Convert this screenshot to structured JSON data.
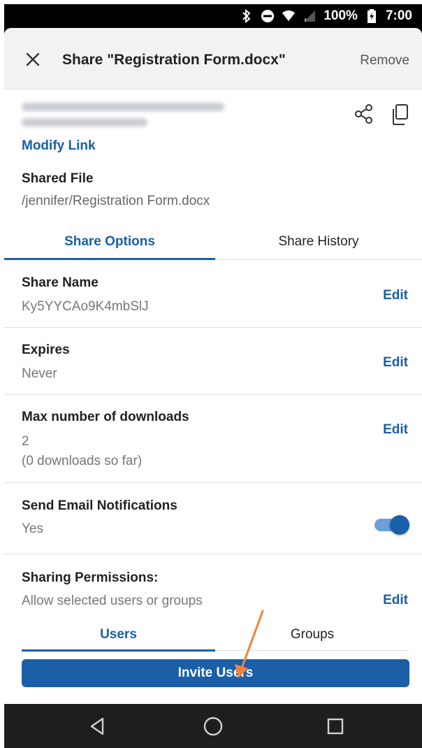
{
  "status_bar": {
    "battery": "100%",
    "time": "7:00",
    "icons": [
      "bluetooth-icon",
      "do-not-disturb-icon",
      "wifi-icon",
      "signal-icon",
      "battery-icon"
    ]
  },
  "header": {
    "title": "Share \"Registration Form.docx\"",
    "remove_label": "Remove",
    "close_icon": "close-icon"
  },
  "link": {
    "url": "(blurred)",
    "share_icon": "share-icon",
    "copy_icon": "copy-icon",
    "modify_label": "Modify Link"
  },
  "shared_file": {
    "label": "Shared File",
    "path": "/jennifer/Registration Form.docx"
  },
  "tabs": [
    {
      "label": "Share Options",
      "active": true
    },
    {
      "label": "Share History",
      "active": false
    }
  ],
  "options": {
    "share_name": {
      "label": "Share Name",
      "value": "Ky5YYCAo9K4mbSlJ",
      "action": "Edit"
    },
    "expires": {
      "label": "Expires",
      "value": "Never",
      "action": "Edit"
    },
    "max_downloads": {
      "label": "Max number of downloads",
      "value": "2",
      "note": "(0 downloads so far)",
      "action": "Edit"
    },
    "email_notifications": {
      "label": "Send Email Notifications",
      "value": "Yes",
      "enabled": true
    },
    "sharing_permissions": {
      "label": "Sharing Permissions:",
      "value": "Allow selected users or groups",
      "action": "Edit"
    }
  },
  "sub_tabs": [
    {
      "label": "Users",
      "active": true
    },
    {
      "label": "Groups",
      "active": false
    }
  ],
  "invite_button": {
    "label": "Invite Users"
  },
  "nav_bar": {
    "icons": [
      "back-icon",
      "home-icon",
      "recents-icon"
    ]
  },
  "colors": {
    "accent": "#1a5fa8",
    "header_bg": "#f2f2f2",
    "annotation_arrow": "#f0843c"
  }
}
